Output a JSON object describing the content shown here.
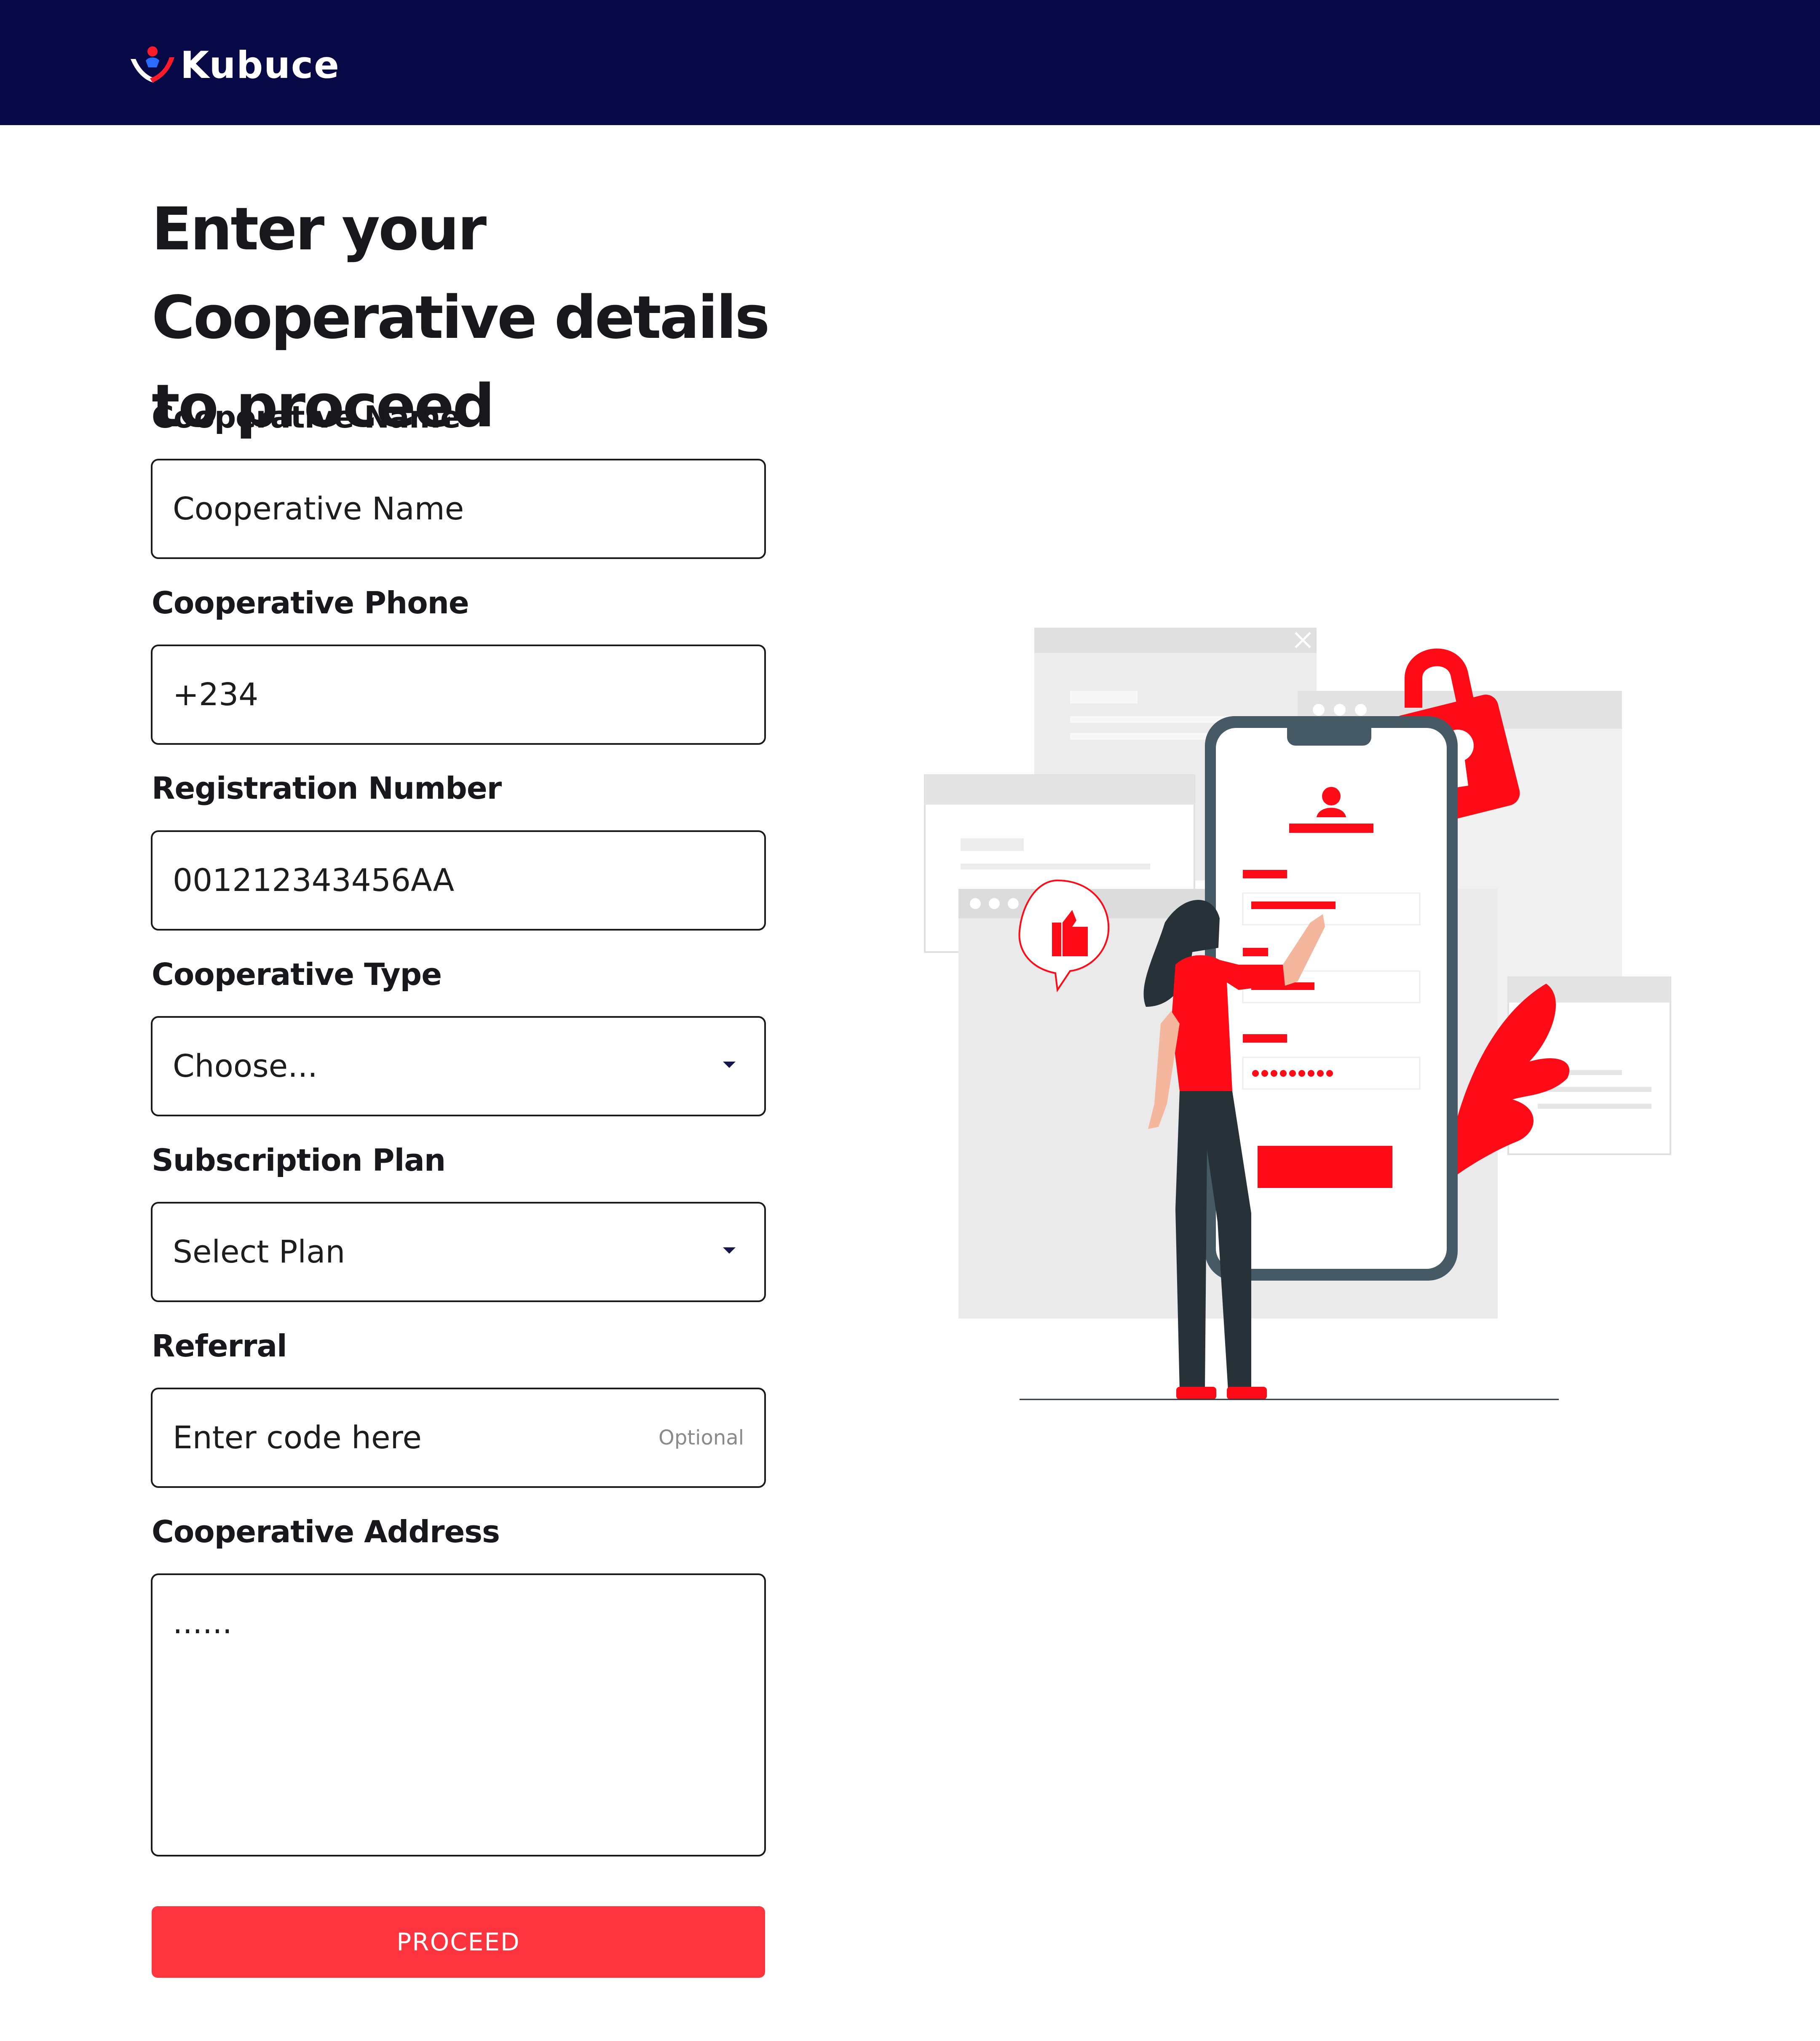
{
  "header": {
    "brand": "Kubuce",
    "background": "#070846"
  },
  "page_title": "Enter your Cooperative details to proceed",
  "form": {
    "cooperative_name": {
      "label": "Cooperative Name",
      "placeholder": "Cooperative Name"
    },
    "cooperative_phone": {
      "label": "Cooperative Phone",
      "value": "+234"
    },
    "registration_number": {
      "label": "Registration Number",
      "value": "001212343456AA"
    },
    "cooperative_type": {
      "label": "Cooperative Type",
      "selected": "Choose..."
    },
    "subscription_plan": {
      "label": "Subscription Plan",
      "selected": "Select Plan"
    },
    "referral": {
      "label": "Referral",
      "placeholder": "Enter code here",
      "hint": "Optional"
    },
    "cooperative_address": {
      "label": "Cooperative Address",
      "placeholder": "......"
    },
    "submit_label": "PROCEED"
  },
  "colors": {
    "accent": "#fe353e",
    "illustration_red": "#ff0a17",
    "phone_frame": "#455a64"
  },
  "illustration": {
    "icons": [
      "smartphone-icon",
      "padlock-icon",
      "thumbs-up-icon",
      "user-icon",
      "leaf-icon",
      "close-icon"
    ]
  }
}
